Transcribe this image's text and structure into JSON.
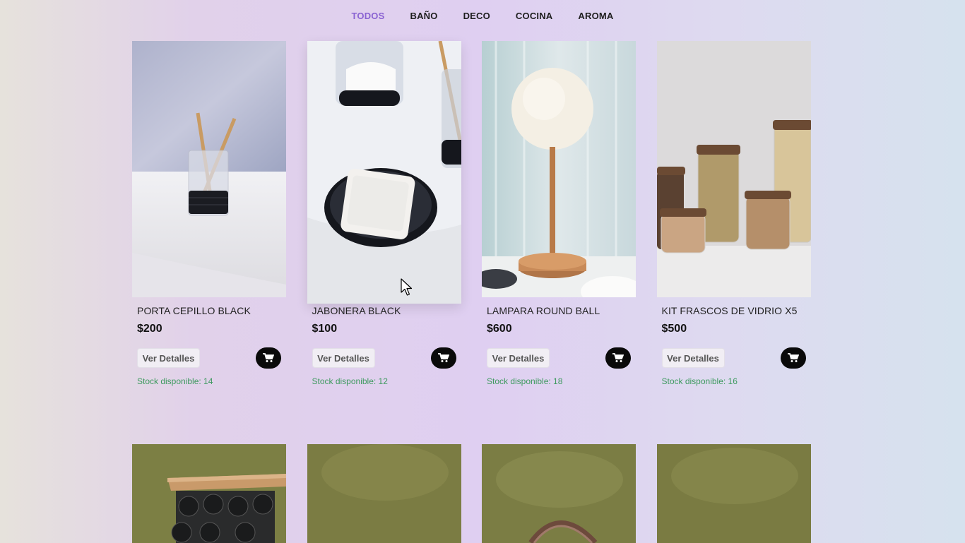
{
  "nav": {
    "items": [
      {
        "label": "TODOS",
        "active": true
      },
      {
        "label": "BAÑO",
        "active": false
      },
      {
        "label": "DECO",
        "active": false
      },
      {
        "label": "COCINA",
        "active": false
      },
      {
        "label": "AROMA",
        "active": false
      }
    ],
    "active_color": "#8a63d2"
  },
  "products": [
    {
      "name": "PORTA CEPILLO BLACK",
      "price": "$200",
      "details_label": "Ver Detalles",
      "stock": "Stock disponible: 14",
      "image": "toothbrush-holder-photo"
    },
    {
      "name": "JABONERA BLACK",
      "price": "$100",
      "details_label": "Ver Detalles",
      "stock": "Stock disponible: 12",
      "image": "soap-dish-photo"
    },
    {
      "name": "LAMPARA ROUND BALL",
      "price": "$600",
      "details_label": "Ver Detalles",
      "stock": "Stock disponible: 18",
      "image": "round-ball-lamp-photo"
    },
    {
      "name": "KIT FRASCOS DE VIDRIO X5",
      "price": "$500",
      "details_label": "Ver Detalles",
      "stock": "Stock disponible: 16",
      "image": "glass-jars-photo"
    }
  ],
  "second_row_images": [
    "spice-rack-photo",
    "olive-backdrop-photo",
    "wood-handle-photo",
    "olive-backdrop-photo"
  ],
  "colors": {
    "stock_text": "#3e9a5f",
    "cart_button": "#0a0a0a"
  },
  "icons": {
    "cart": "cart-icon",
    "cursor": "mouse-pointer-icon"
  }
}
